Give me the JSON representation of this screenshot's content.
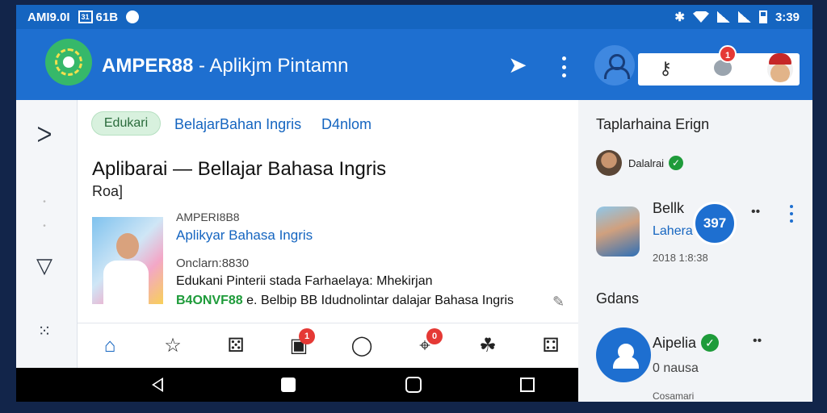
{
  "status_bar": {
    "carrier": "AMI9.0I",
    "battery_pct": "61B",
    "time": "3:39"
  },
  "app_bar": {
    "title": "AMPER88",
    "subtitle": " - Aplikjm Pintamn",
    "notification_count": "1"
  },
  "main": {
    "chip": "Edukari",
    "tabs": [
      "BelajarBahan Ingris",
      "D4nlom"
    ],
    "headline": "Aplibarai — Bellajar Bahasa Ingris",
    "sub": "Roa]",
    "article": {
      "label": "AMPERI8B8",
      "title": "Aplikyar Bahasa Ingris",
      "date": "Onclarn:8830",
      "desc": "Edukani Pinterii stada Farhaelaya: Mhekirjan",
      "line_green": "B4ONVF88",
      "line_rest": " e. Belbip BB Idudnolintar dalajar Bahasa Ingris"
    },
    "nav_badges": [
      "1",
      "0"
    ]
  },
  "right_panel": {
    "title": "Taplarhaina Erign",
    "author": "Dalalrai",
    "card": {
      "title": "Bellk",
      "sub": "Lahera",
      "date": "2018 1:8:38",
      "count": "397"
    },
    "section": "Gdans",
    "contact": {
      "name": "Aipelia",
      "status": "0 nausa",
      "sub": "Cosamari"
    }
  },
  "icons": {
    "send": "send-icon",
    "more": "more-vertical-icon",
    "profile": "person-icon",
    "key": "key-icon",
    "chat": "chat-icon"
  },
  "colors": {
    "primary": "#1e6fd0",
    "status_bar": "#1565c0",
    "accent_green": "#1e9b3a",
    "badge_red": "#e53935"
  }
}
